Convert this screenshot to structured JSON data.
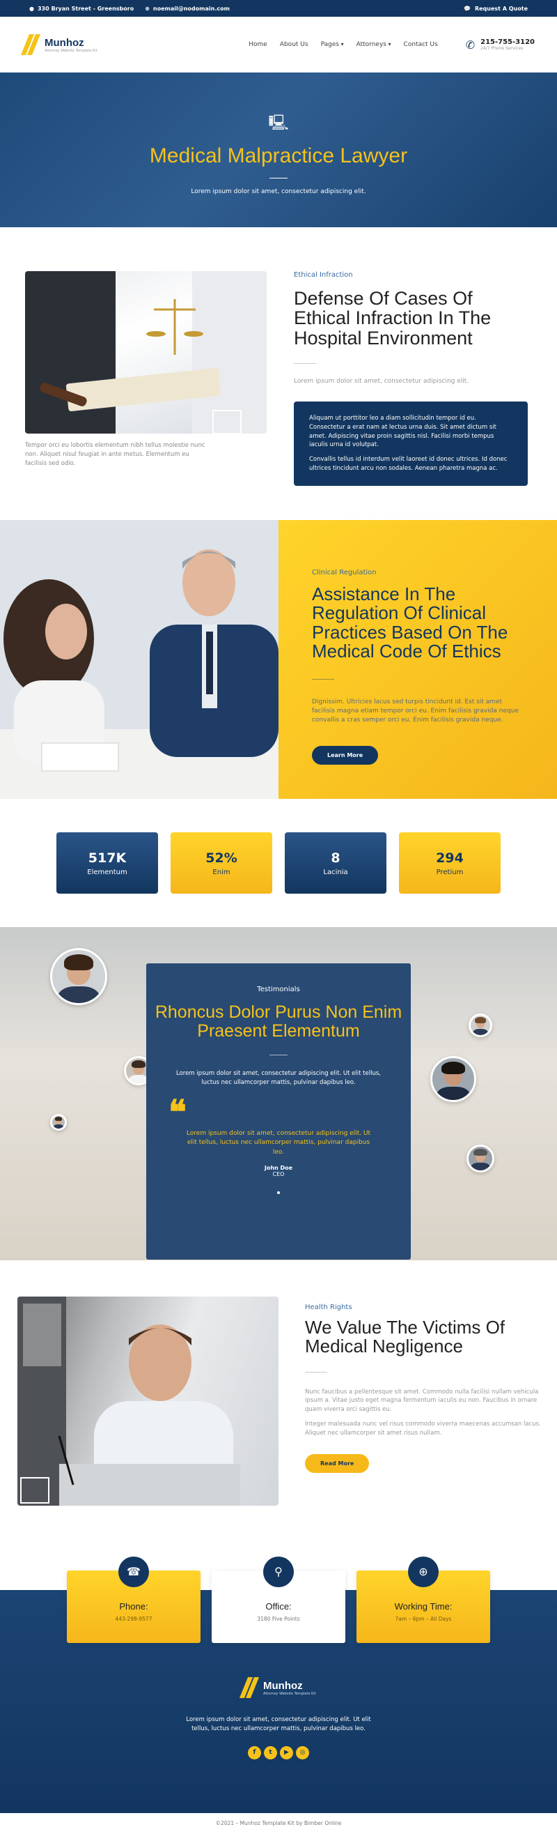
{
  "topbar": {
    "address": "330 Bryan Street - Greensboro",
    "email": "noemail@nodomain.com",
    "quote": "Request A Quote"
  },
  "header": {
    "logo_name": "Munhoz",
    "logo_tagline": "Attorney Website Template Kit",
    "nav": [
      "Home",
      "About Us",
      "Pages",
      "Attorneys",
      "Contact Us"
    ],
    "phone": "215-755-3120",
    "phone_sub": "24/7 Phone Services"
  },
  "hero": {
    "title": "Medical Malpractice Lawyer",
    "subtitle": "Lorem ipsum dolor sit amet, consectetur adipiscing elit."
  },
  "section1": {
    "caption": "Tempor orci eu lobortis elementum nibh tellus molestie nunc non. Aliquet nisul feugiat in ante metus. Elementum eu facilisis sed odio.",
    "eyebrow": "Ethical Infraction",
    "title": "Defense Of Cases Of Ethical Infraction In The Hospital Environment",
    "lead": "Lorem ipsum dolor sit amet, consectetur adipiscing elit.",
    "box_p1": "Aliquam ut porttitor leo a diam sollicitudin tempor id eu. Consectetur a erat nam at lectus urna duis. Sit amet dictum sit amet. Adipiscing vitae proin sagittis nisl. Facilisi morbi tempus iaculis urna id volutpat.",
    "box_p2": "Convallis tellus id interdum velit laoreet id donec ultrices. Id donec ultrices tincidunt arcu non sodales. Aenean pharetra magna ac."
  },
  "section2": {
    "eyebrow": "Clinical Regulation",
    "title": "Assistance In The Regulation Of Clinical Practices Based On The Medical Code Of Ethics",
    "text": "Dignissim. Ultricies lacus sed turpis tincidunt id. Est sit amet facilisis magna etiam tempor orci eu. Enim facilisis gravida neque convallis a cras semper orci eu. Enim facilisis gravida neque.",
    "button": "Learn More"
  },
  "stats": [
    {
      "value": "517K",
      "label": "Elementum"
    },
    {
      "value": "52%",
      "label": "Enim"
    },
    {
      "value": "8",
      "label": "Lacinia"
    },
    {
      "value": "294",
      "label": "Pretium"
    }
  ],
  "testimonials": {
    "eyebrow": "Testimonials",
    "title": "Rhoncus Dolor Purus Non Enim Praesent Elementum",
    "description": "Lorem ipsum dolor sit amet, consectetur adipiscing elit. Ut elit tellus, luctus nec ullamcorper mattis, pulvinar dapibus leo.",
    "quote_mark": "❝",
    "quote": "Lorem ipsum dolor sit amet, consectetur adipiscing elit. Ut elit tellus, luctus nec ullamcorper mattis, pulvinar dapibus leo.",
    "name": "John Doe",
    "role": "CEO"
  },
  "section4": {
    "eyebrow": "Health Rights",
    "title": "We Value The Victims Of Medical Negligence",
    "p1": "Nunc faucibus a pellentesque sit amet. Commodo nulla facilisi nullam vehicula ipsum a. Vitae justo eget magna fermentum iaculis eu non. Faucibus in ornare quam viverra orci sagittis eu.",
    "p2": "Integer malesuada nunc vel risus commodo viverra maecenas accumsan lacus. Aliquet nec ullamcorper sit amet risus nullam.",
    "button": "Read More"
  },
  "contact_cards": [
    {
      "title": "Phone:",
      "value": "443-298-9577",
      "icon": "phone-icon",
      "glyph": "☎"
    },
    {
      "title": "Office:",
      "value": "3180 Five Points",
      "icon": "location-pin-icon",
      "glyph": "⚲"
    },
    {
      "title": "Working Time:",
      "value": "7am – 6pm – All Days",
      "icon": "globe-icon",
      "glyph": "⊕"
    }
  ],
  "footer": {
    "logo_name": "Munhoz",
    "logo_tagline": "Attorney Website Template Kit",
    "text": "Lorem ipsum dolor sit amet, consectetur adipiscing elit. Ut elit tellus, luctus nec ullamcorper mattis, pulvinar dapibus leo.",
    "socials": [
      "f",
      "t",
      "▶",
      "◎"
    ],
    "copyright": "©2021 – Munhoz Template Kit by Bimber Online"
  },
  "colors": {
    "navy": "#12365f",
    "yellow": "#f7c21a"
  }
}
